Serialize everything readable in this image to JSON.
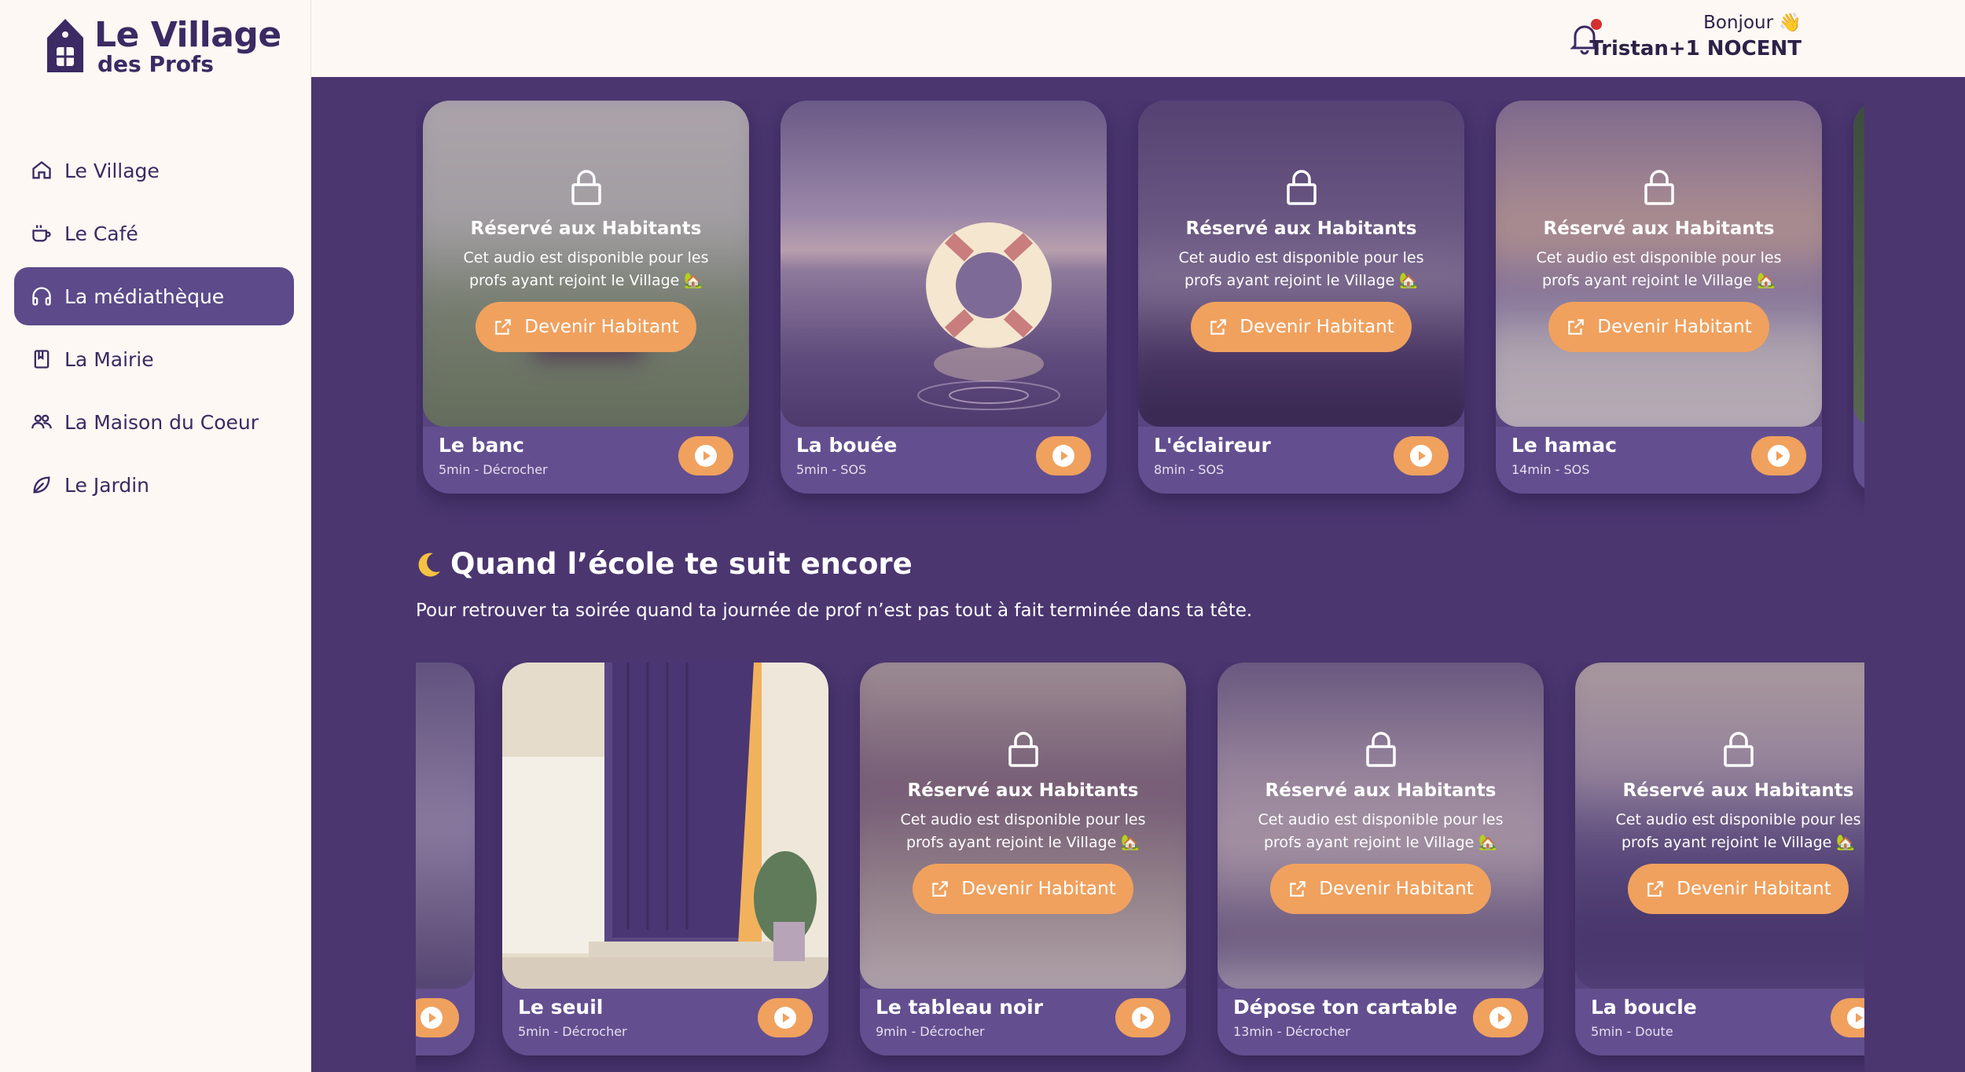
{
  "logo": {
    "title": "Le Village",
    "subtitle": "des Profs"
  },
  "nav": [
    {
      "label": "Le Village",
      "icon": "home-icon",
      "active": false
    },
    {
      "label": "Le Café",
      "icon": "coffee-icon",
      "active": false
    },
    {
      "label": "La médiathèque",
      "icon": "headphones-icon",
      "active": true
    },
    {
      "label": "La Mairie",
      "icon": "book-icon",
      "active": false
    },
    {
      "label": "La Maison du Coeur",
      "icon": "users-icon",
      "active": false
    },
    {
      "label": "Le Jardin",
      "icon": "leaf-icon",
      "active": false
    }
  ],
  "header": {
    "greeting": "Bonjour 👋",
    "user_name": "Tristan+1 NOCENT"
  },
  "locked": {
    "title": "Réservé aux Habitants",
    "description": "Cet audio est disponible pour les profs ayant rejoint le Village 🏡",
    "cta": "Devenir Habitant"
  },
  "row1": [
    {
      "title": "Le banc",
      "meta": "5min - Décrocher",
      "locked": true
    },
    {
      "title": "La bouée",
      "meta": "5min - SOS",
      "locked": false
    },
    {
      "title": "L'éclaireur",
      "meta": "8min - SOS",
      "locked": true
    },
    {
      "title": "Le hamac",
      "meta": "14min - SOS",
      "locked": true
    }
  ],
  "section2": {
    "title": "Quand l’école te suit encore",
    "description": "Pour retrouver ta soirée quand ta journée de prof n’est pas tout à fait terminée dans ta tête."
  },
  "row2": [
    {
      "title": "Le seuil",
      "meta": "5min - Décrocher",
      "locked": false
    },
    {
      "title": "Le tableau noir",
      "meta": "9min - Décrocher",
      "locked": true
    },
    {
      "title": "Dépose ton cartable",
      "meta": "13min - Décrocher",
      "locked": true
    },
    {
      "title": "La boucle",
      "meta": "5min - Doute",
      "locked": true
    }
  ],
  "colors": {
    "accent": "#f0a15e",
    "background": "#4b3670",
    "card": "#634f8f",
    "sidebar": "#fdf8f3",
    "brand": "#3b2a63"
  }
}
